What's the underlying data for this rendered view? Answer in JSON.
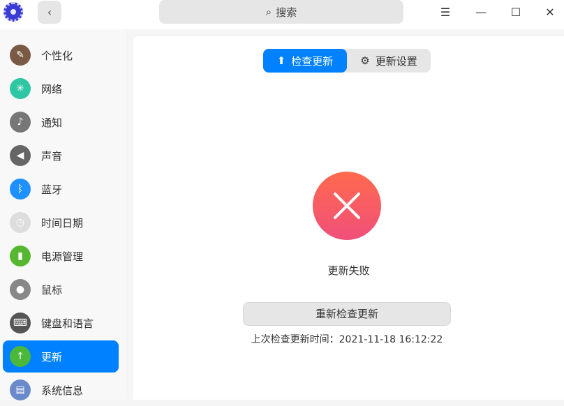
{
  "titlebar": {
    "search_placeholder": "搜索",
    "back": "‹",
    "menu": "☰",
    "minimize": "—",
    "maximize": "☐",
    "close": "✕"
  },
  "sidebar": {
    "items": [
      {
        "label": "个性化",
        "icon": "palette-icon",
        "color": "#7a5a44",
        "glyph": "✎"
      },
      {
        "label": "网络",
        "icon": "network-icon",
        "color": "#2fc6a4",
        "glyph": "✳"
      },
      {
        "label": "通知",
        "icon": "bell-icon",
        "color": "#777777",
        "glyph": "♪"
      },
      {
        "label": "声音",
        "icon": "speaker-icon",
        "color": "#666666",
        "glyph": "◀"
      },
      {
        "label": "蓝牙",
        "icon": "bluetooth-icon",
        "color": "#1e90ff",
        "glyph": "ᛒ"
      },
      {
        "label": "时间日期",
        "icon": "clock-icon",
        "color": "#dddddd",
        "glyph": "◷"
      },
      {
        "label": "电源管理",
        "icon": "battery-icon",
        "color": "#55b830",
        "glyph": "▮"
      },
      {
        "label": "鼠标",
        "icon": "mouse-icon",
        "color": "#888888",
        "glyph": "●"
      },
      {
        "label": "键盘和语言",
        "icon": "keyboard-icon",
        "color": "#555555",
        "glyph": "⌨"
      },
      {
        "label": "更新",
        "icon": "update-icon",
        "color": "#4cb83a",
        "glyph": "↑"
      },
      {
        "label": "系统信息",
        "icon": "system-info-icon",
        "color": "#6a8acb",
        "glyph": "▤"
      }
    ],
    "active": 9
  },
  "main": {
    "tabs": [
      {
        "label": "检查更新"
      },
      {
        "label": "更新设置"
      }
    ],
    "status": "更新失败",
    "retry_button": "重新检查更新",
    "last_check_label": "上次检查更新时间：2021-11-18 16:12:22"
  }
}
